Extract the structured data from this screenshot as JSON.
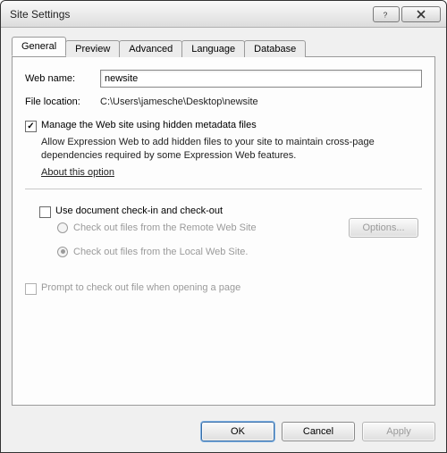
{
  "window": {
    "title": "Site Settings"
  },
  "tabs": [
    {
      "label": "General"
    },
    {
      "label": "Preview"
    },
    {
      "label": "Advanced"
    },
    {
      "label": "Language"
    },
    {
      "label": "Database"
    }
  ],
  "general": {
    "web_name_label": "Web name:",
    "web_name_value": "newsite",
    "file_location_label": "File location:",
    "file_location_value": "C:\\Users\\jamesche\\Desktop\\newsite",
    "manage_meta": {
      "label": "Manage the Web site using hidden metadata files",
      "checked": true,
      "description": "Allow Expression Web to add hidden files to your site to maintain cross-page dependencies required by some Expression Web features.",
      "about_link": "About this option"
    },
    "checkin": {
      "label": "Use document check-in and check-out",
      "checked": false,
      "radio_remote": "Check out files from the Remote Web Site",
      "radio_local": "Check out files from the Local Web Site.",
      "options_btn": "Options...",
      "prompt_label": "Prompt to check out file when opening a page",
      "prompt_checked": false
    }
  },
  "buttons": {
    "ok": "OK",
    "cancel": "Cancel",
    "apply": "Apply"
  }
}
